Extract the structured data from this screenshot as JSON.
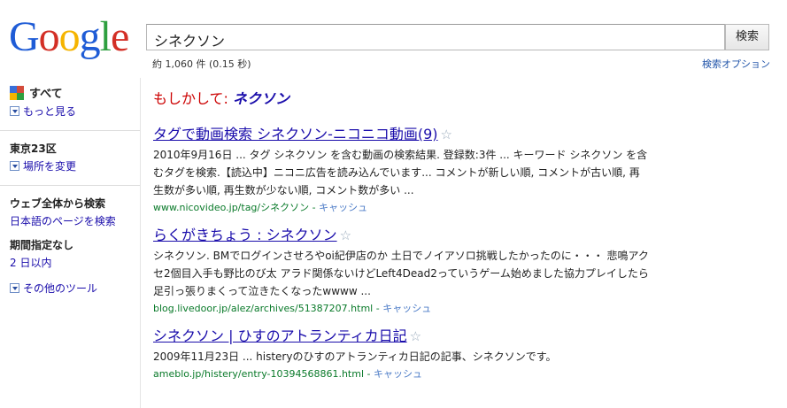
{
  "logo": {
    "letters": [
      "G",
      "o",
      "o",
      "g",
      "l",
      "e"
    ],
    "colors": [
      "#1f5cd6",
      "#d32f26",
      "#f5b400",
      "#1f5cd6",
      "#2e9f3f",
      "#d32f26"
    ]
  },
  "search": {
    "query": "シネクソン",
    "button_label": "検索"
  },
  "stats": "約 1,060 件 (0.15 秒)",
  "advanced_link": "検索オプション",
  "sidebar": {
    "all_label": "すべて",
    "more_label": "もっと見る",
    "location_title": "東京23区",
    "change_location": "場所を変更",
    "web_title": "ウェブ全体から検索",
    "japanese_pages": "日本語のページを検索",
    "period_title": "期間指定なし",
    "period_2days": "2 日以内",
    "other_tools": "その他のツール"
  },
  "did_you_mean": {
    "prefix": "もしかして: ",
    "suggestion": "ネクソン"
  },
  "results": [
    {
      "title": "タグで動画検索 シネクソン-ニコニコ動画(9)",
      "snippet": "2010年9月16日 ... タグ シネクソン を含む動画の検索結果. 登録数:3件 ... キーワード シネクソン を含むタグを検索.【読込中】ニコニ広告を読み込んでいます... コメントが新しい順, コメントが古い順, 再生数が多い順, 再生数が少ない順, コメント数が多い ...",
      "url": "www.nicovideo.jp/tag/シネクソン",
      "cache": "キャッシュ"
    },
    {
      "title": "らくがきちょう : シネクソン",
      "snippet": "シネクソン. BMでログインさせろやoi紀伊店のか 土日でノイアソロ挑戦したかったのに・・・ 悲鳴アクセ2個目入手も野比のび太 アラド関係ないけどLeft4Dead2っていうゲーム始めました協力プレイしたら足引っ張りまくって泣きたくなったwwww ...",
      "url": "blog.livedoor.jp/alez/archives/51387207.html",
      "cache": "キャッシュ"
    },
    {
      "title": "シネクソン | ひすのアトランティカ日記",
      "snippet": "2009年11月23日 ... histeryのひすのアトランティカ日記の記事、シネクソンです。",
      "url": "ameblo.jp/histery/entry-10394568861.html",
      "cache": "キャッシュ"
    }
  ]
}
